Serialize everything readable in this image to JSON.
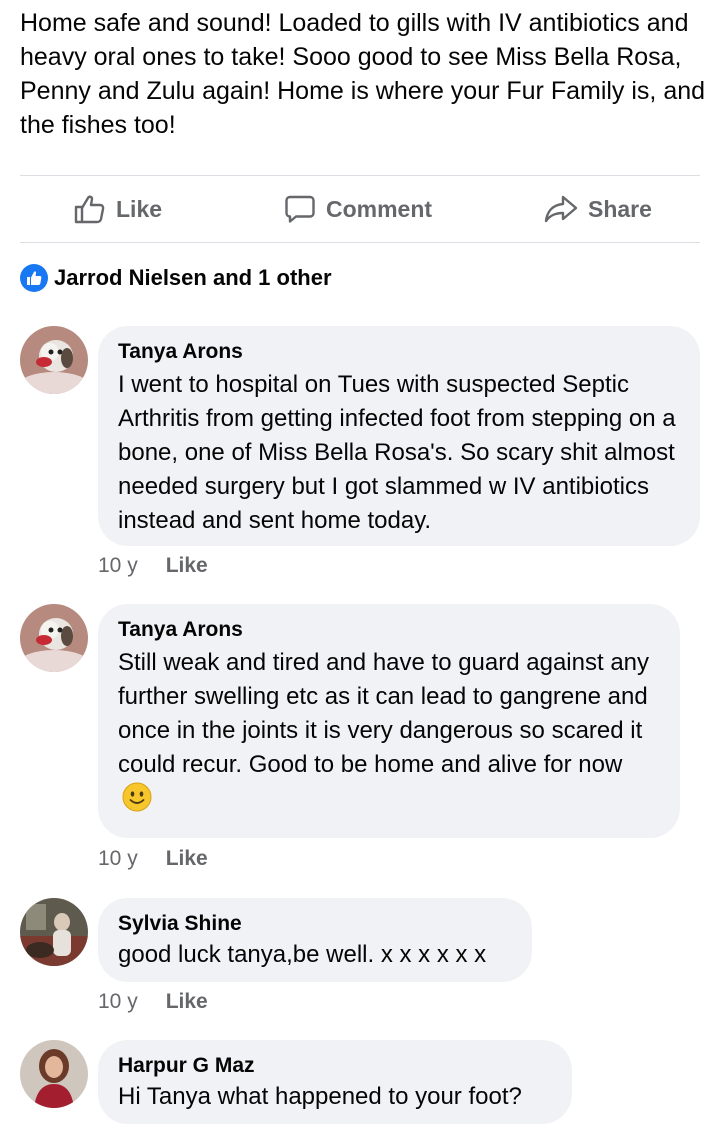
{
  "post": {
    "text": "Home safe and sound!  Loaded to gills with IV antibiotics and heavy oral ones to take!  Sooo good to see Miss Bella Rosa, Penny and Zulu again!  Home is where your Fur Family is, and the fishes too!"
  },
  "actions": {
    "like_label": "Like",
    "comment_label": "Comment",
    "share_label": "Share"
  },
  "reactions": {
    "summary": "Jarrod Nielsen and 1 other"
  },
  "comments": [
    {
      "author": "Tanya Arons",
      "text": "I went to hospital on Tues with suspected Septic Arthritis from getting infected foot from stepping on a bone, one of Miss Bella Rosa's.  So scary shit almost needed surgery but I got slammed w IV antibiotics instead and sent home today.",
      "time": "10 y",
      "like_label": "Like"
    },
    {
      "author": "Tanya Arons",
      "text": "Still weak and tired and have to guard against any further swelling etc as it can lead to gangrene and once in the joints it is very dangerous so scared it could recur. Good to be home and alive for now",
      "time": "10 y",
      "like_label": "Like"
    },
    {
      "author": "Sylvia Shine",
      "text": "good luck tanya,be well. x x x x x x",
      "time": "10 y",
      "like_label": "Like"
    },
    {
      "author": "Harpur G Maz",
      "text": "Hi Tanya what happened to your foot?"
    }
  ],
  "colors": {
    "accent": "#1877f2",
    "secondary_text": "#65676b",
    "bubble": "#f0f2f5"
  }
}
